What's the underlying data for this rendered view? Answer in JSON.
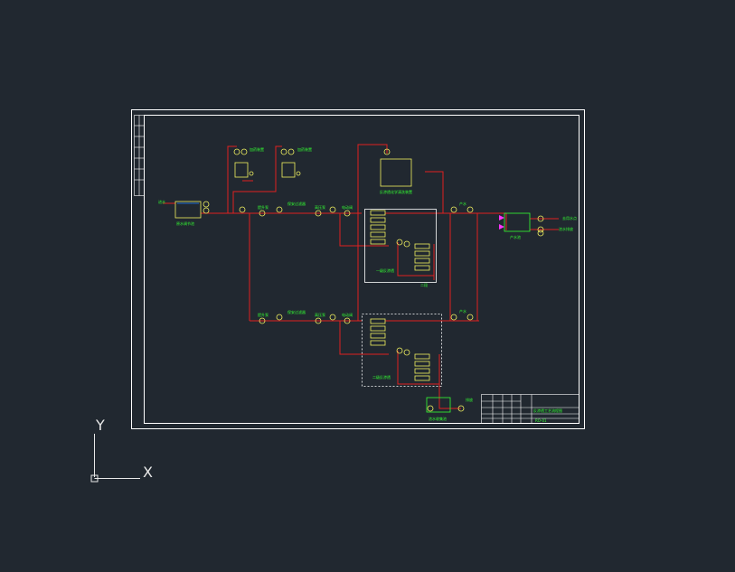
{
  "app": "CAD drawing viewport",
  "colors": {
    "background": "#212830",
    "frame": "#ffffff",
    "pipe": "#e02020",
    "equipment": "#f0f060",
    "text": "#33ff33",
    "water": "#2080ff",
    "magenta": "#ff33ff",
    "ucs": "#e8e8e8"
  },
  "drawing": {
    "labels": {
      "dosing_1": "加药装置",
      "dosing_2": "加药装置",
      "inlet": "进水",
      "raw_tank": "原水调节池",
      "pump_1": "提升泵",
      "filter_1": "保安过滤器",
      "pump_2": "高压泵",
      "valve_1": "电动阀",
      "cleaning_tank": "反渗透化学清洗装置",
      "ro_unit_1": "一级反渗透",
      "ro_stage_1": "二段",
      "product_1": "产水",
      "product_tank": "产水池",
      "to_use_1": "去用水点",
      "to_use_2": "浓水排放",
      "pump_3": "提升泵",
      "filter_2": "保安过滤器",
      "pump_4": "高压泵",
      "valve_2": "电动阀",
      "ro_unit_2": "二级反渗透",
      "product_2": "产水",
      "conc_tank": "浓水收集池",
      "discharge": "排放"
    },
    "title_block": {
      "title": "反渗透工艺流程图",
      "drawing_no": "RO-01"
    }
  },
  "ucs": {
    "y_label": "Y",
    "x_label": "X"
  }
}
